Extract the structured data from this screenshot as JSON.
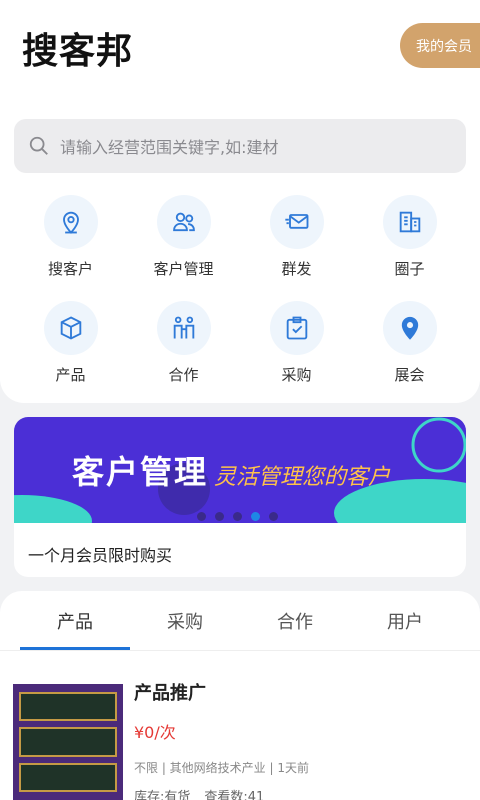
{
  "app": {
    "title": "搜客邦",
    "member_label": "我的会员"
  },
  "search": {
    "placeholder": "请输入经营范围关键字,如:建材"
  },
  "grid": [
    {
      "label": "搜客户",
      "icon": "location-search-icon"
    },
    {
      "label": "客户管理",
      "icon": "users-icon"
    },
    {
      "label": "群发",
      "icon": "mail-send-icon"
    },
    {
      "label": "圈子",
      "icon": "building-icon"
    },
    {
      "label": "产品",
      "icon": "box-icon"
    },
    {
      "label": "合作",
      "icon": "handshake-icon"
    },
    {
      "label": "采购",
      "icon": "clipboard-check-icon"
    },
    {
      "label": "展会",
      "icon": "map-pin-icon"
    }
  ],
  "banner": {
    "title": "客户管理",
    "subtitle": "灵活管理您的客户",
    "caption": "一个月会员限时购买",
    "active_dot": 3
  },
  "tabs": [
    {
      "label": "产品"
    },
    {
      "label": "采购"
    },
    {
      "label": "合作"
    },
    {
      "label": "用户"
    }
  ],
  "product": {
    "title": "产品推广",
    "price": "¥0/次",
    "meta": "不限 | 其他网络技术产业 | 1天前",
    "stock": "库存:有货",
    "views": "查看数:41"
  },
  "colors": {
    "accent": "#1e73d8",
    "member": "#d2a36c",
    "price": "#e53935",
    "banner_bg": "#4b2fd6"
  }
}
